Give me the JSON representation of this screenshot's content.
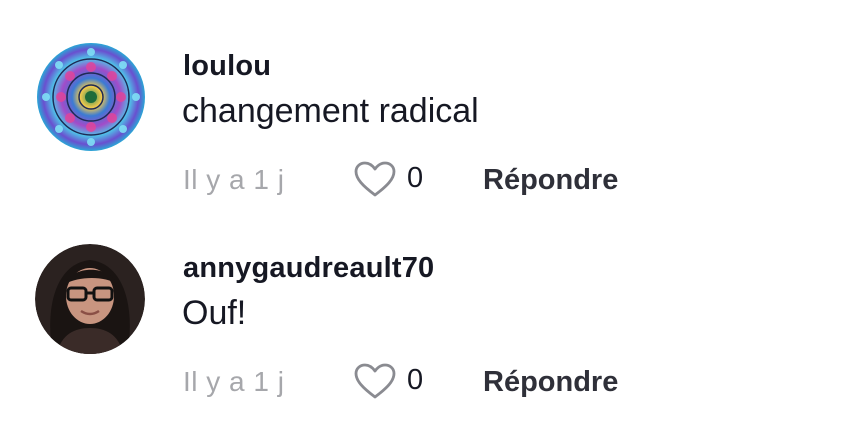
{
  "comments": [
    {
      "username": "loulou",
      "text": "changement radical",
      "time": "Il y a 1 j",
      "likes": "0",
      "reply_label": "Répondre",
      "avatar": "mandala-avatar"
    },
    {
      "username": "annygaudreault70",
      "text": "Ouf!",
      "time": "Il y a 1 j",
      "likes": "0",
      "reply_label": "Répondre",
      "avatar": "profile-photo-avatar"
    }
  ],
  "colors": {
    "text_primary": "#161823",
    "text_secondary": "#a6a7ab",
    "icon_stroke": "#8a8b91"
  }
}
